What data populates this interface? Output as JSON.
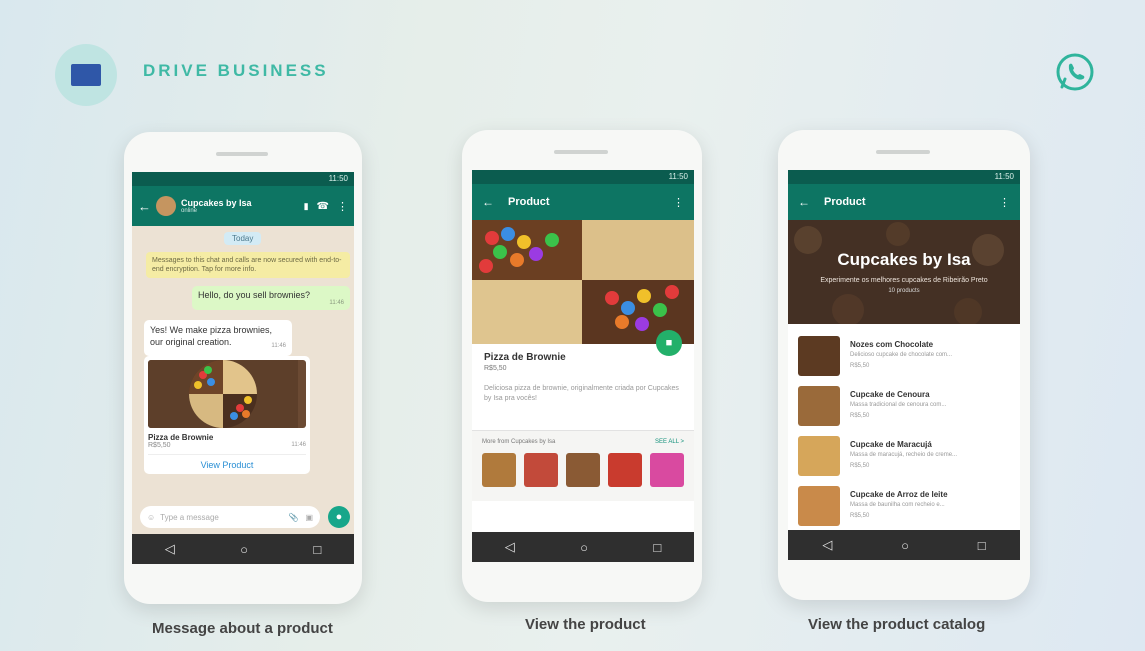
{
  "header": {
    "brand_title": "DRIVE BUSINESS",
    "logo_icon": "brand-logo-icon",
    "whatsapp_icon": "whatsapp-icon"
  },
  "colors": {
    "accent": "#3fb9a5",
    "appbar": "#0d7563",
    "statusbar": "#0b5c4f",
    "outgoing_bubble": "#dcf8c6",
    "fab": "#23b06a"
  },
  "status_time": "11:50",
  "nav_icons": [
    "back-triangle-icon",
    "home-circle-icon",
    "recents-square-icon"
  ],
  "phone1": {
    "contact_name": "Cupcakes by Isa",
    "contact_status": "online",
    "date_chip": "Today",
    "system_message": "Messages to this chat and calls are now secured with end-to-end encryption. Tap for more info.",
    "outgoing_text": "Hello, do you sell brownies?",
    "outgoing_time": "11:46",
    "incoming_text": "Yes! We make pizza brownies, our original creation.",
    "incoming_time": "11:46",
    "product_name": "Pizza de Brownie",
    "product_price": "R$5,50",
    "product_time": "11:46",
    "view_button": "View Product",
    "input_placeholder": "Type a message",
    "caption": "Message about a product"
  },
  "phone2": {
    "title": "Product",
    "product_name": "Pizza de Brownie",
    "product_price": "R$5,50",
    "product_description": "Deliciosa pizza de brownie, originalmente criada por Cupcakes by Isa pra vocês!",
    "more_from": "More from Cupcakes by Isa",
    "see_all": "SEE ALL >",
    "caption": "View the product"
  },
  "phone3": {
    "title": "Product",
    "business_name": "Cupcakes by Isa",
    "business_tagline": "Experimente os melhores cupcakes de Ribeirão Preto",
    "product_count": "10 products",
    "items": [
      {
        "name": "Nozes com Chocolate",
        "desc": "Delicioso cupcake de chocolate com...",
        "price": "R$5,50"
      },
      {
        "name": "Cupcake de Cenoura",
        "desc": "Massa tradicional de cenoura com...",
        "price": "R$5,50"
      },
      {
        "name": "Cupcake de Maracujá",
        "desc": "Massa de maracujá, recheio de creme...",
        "price": "R$5,50"
      },
      {
        "name": "Cupcake de Arroz de leite",
        "desc": "Massa de baunilha com recheio e...",
        "price": "R$5,50"
      }
    ],
    "caption": "View the product catalog"
  }
}
